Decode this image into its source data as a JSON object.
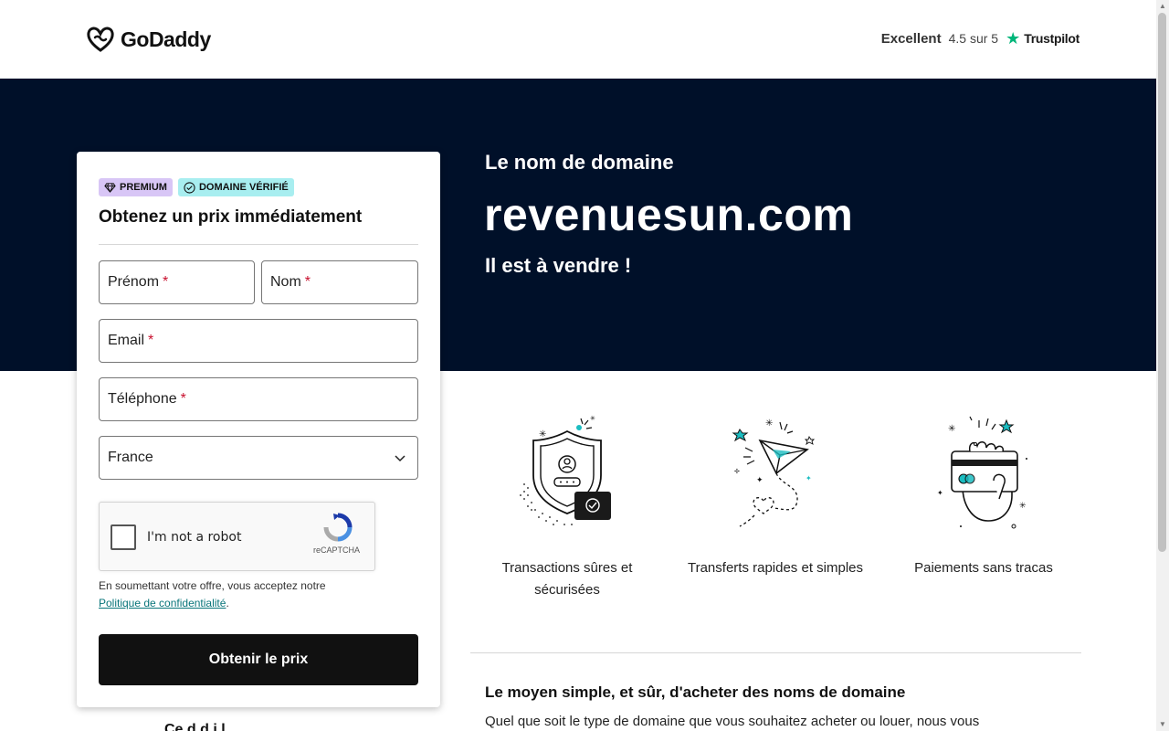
{
  "header": {
    "logo_text": "GoDaddy",
    "rating_label": "Excellent",
    "rating_score": "4.5 sur 5",
    "trustpilot": "Trustpilot"
  },
  "hero": {
    "subtitle": "Le nom de domaine",
    "domain": "revenuesun.com",
    "sale_text": "Il est à vendre !"
  },
  "form": {
    "badge_premium": "PREMIUM",
    "badge_verified": "DOMAINE VÉRIFIÉ",
    "title": "Obtenez un prix immédiatement",
    "first_name_label": "Prénom",
    "last_name_label": "Nom",
    "email_label": "Email",
    "phone_label": "Téléphone",
    "required_mark": "*",
    "country_value": "France",
    "captcha_label": "I'm not a robot",
    "captcha_brand": "reCAPTCHA",
    "terms_text": "En soumettant votre offre, vous acceptez notre",
    "terms_link": "Politique de confidentialité",
    "terms_end": ".",
    "submit_label": "Obtenir le prix"
  },
  "below_card_text": "Ce d d i l",
  "features": [
    {
      "label": "Transactions sûres et sécurisées",
      "icon": "shield-icon"
    },
    {
      "label": "Transferts rapides et simples",
      "icon": "paper-plane-icon"
    },
    {
      "label": "Paiements sans tracas",
      "icon": "credit-card-hand-icon"
    }
  ],
  "section": {
    "title": "Le moyen simple, et sûr, d'acheter des noms de domaine",
    "text": "Quel que soit le type de domaine que vous souhaitez acheter ou louer, nous vous"
  },
  "colors": {
    "hero_bg": "#001029",
    "badge_premium_bg": "#d8c6f6",
    "badge_verified_bg": "#a8eef0",
    "button_bg": "#111111",
    "accent_teal": "#1bbdc1",
    "trustpilot_green": "#00b67a"
  }
}
